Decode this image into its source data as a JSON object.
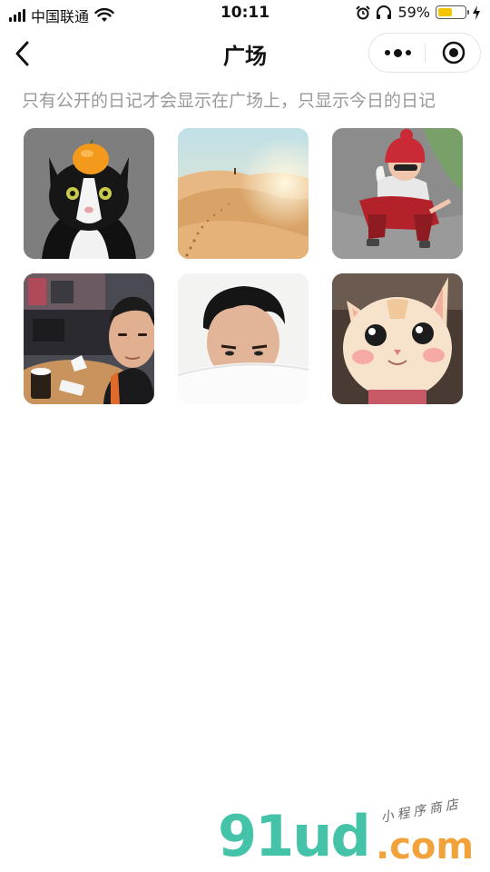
{
  "status_bar": {
    "carrier": "中国联通",
    "time": "10:11",
    "battery_text": "59%",
    "battery_level": 0.59,
    "icons": [
      "signal-icon",
      "wifi-icon",
      "alarm-icon",
      "headphones-icon",
      "battery-icon",
      "charging-icon"
    ]
  },
  "nav": {
    "title": "广场",
    "back_icon": "chevron-left-icon",
    "more_icon": "more-dots-icon",
    "close_icon": "target-close-icon"
  },
  "hint": "只有公开的日记才会显示在广场上，只显示今日的日记",
  "tiles": [
    {
      "subject": "cat-orange-hat"
    },
    {
      "subject": "desert-footprints"
    },
    {
      "subject": "child-red-hat"
    },
    {
      "subject": "selfie-cafe"
    },
    {
      "subject": "boy-portrait"
    },
    {
      "subject": "cat-blush"
    }
  ],
  "watermark": {
    "main": "91ud",
    "com": ".com",
    "small": "小程序商店"
  },
  "colors": {
    "watermark_green": "#44c3a8",
    "watermark_orange": "#f2a23a",
    "battery_fill": "#f5c500",
    "hint_gray": "#999999"
  }
}
